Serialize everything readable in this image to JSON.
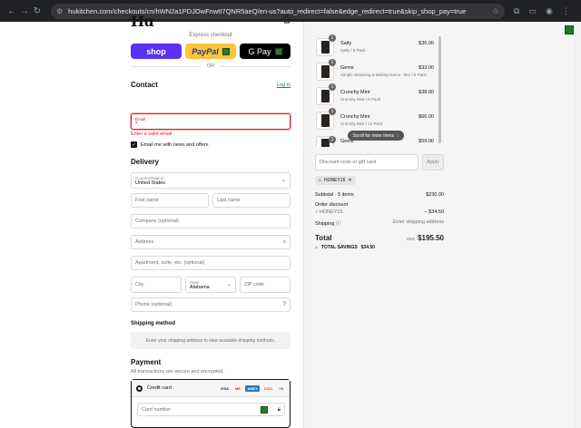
{
  "browser": {
    "back": "←",
    "forward": "→",
    "reload": "↻",
    "url": "hukitchen.com/checkouts/cn/hWN2a1PDJOwFnwtI7QNR5aeQ/en-us?auto_redirect=false&edge_redirect=true&skip_shop_pay=true"
  },
  "brand": {
    "logo": "Hu"
  },
  "express": {
    "label": "Express checkout",
    "shop": "shop",
    "paypal": "PayPal",
    "gpay": "G Pay",
    "or": "OR"
  },
  "contact": {
    "heading": "Contact",
    "login": "Log in",
    "email_label": "Email",
    "email_value": "*",
    "error": "Enter a valid email",
    "newsletter": "Email me with news and offers"
  },
  "delivery": {
    "heading": "Delivery",
    "country_label": "Country/Region",
    "country_value": "United States",
    "first_name": "First name",
    "last_name": "Last name",
    "company": "Company (optional)",
    "address": "Address",
    "apartment": "Apartment, suite, etc. (optional)",
    "city": "City",
    "state_label": "State",
    "state_value": "Alabama",
    "zip": "ZIP code",
    "phone": "Phone (optional)"
  },
  "shipping_method": {
    "heading": "Shipping method",
    "note": "Enter your shipping address to view available shipping methods."
  },
  "payment": {
    "heading": "Payment",
    "subtitle": "All transactions are secure and encrypted.",
    "credit_card": "Credit card",
    "card_number": "Card number",
    "logos": [
      "VISA",
      "MC",
      "AMEX",
      "DISC",
      "+3"
    ]
  },
  "order": {
    "items": [
      {
        "qty": "1",
        "name": "Salty",
        "variant": "Salty / 6 Pack",
        "price": "$36.00"
      },
      {
        "qty": "1",
        "name": "Gems",
        "variant": "Simple Snacking & Baking Gems - 9oz / 6 Pack",
        "price": "$33.00"
      },
      {
        "qty": "1",
        "name": "Crunchy Mint",
        "variant": "Crunchy Mint / 6 Pack",
        "price": "$38.00"
      },
      {
        "qty": "1",
        "name": "Crunchy Mint",
        "variant": "Crunchy Mint / 12 Pack",
        "price": "$66.00"
      },
      {
        "qty": "1",
        "name": "Gems",
        "variant": "",
        "price": "$59.00"
      }
    ],
    "scroll_more": "Scroll for more items",
    "discount_placeholder": "Discount code or gift card",
    "apply": "Apply",
    "discount_code": "HONEY15",
    "subtotal_label": "Subtotal · 5 items",
    "subtotal_value": "$230.00",
    "order_discount_label": "Order discount",
    "order_discount_code": "HONEY15",
    "order_discount_value": "− $34.50",
    "shipping_label": "Shipping",
    "shipping_value": "Enter shipping address",
    "total_label": "Total",
    "total_currency": "USD",
    "total_value": "$195.50",
    "savings_label": "TOTAL SAVINGS",
    "savings_value": "$34.50"
  },
  "colors": {
    "shop_purple": "#5a31f4",
    "paypal_yellow": "#ffc439",
    "error_red": "#dd1d1d",
    "link_blue": "#1773b0"
  }
}
